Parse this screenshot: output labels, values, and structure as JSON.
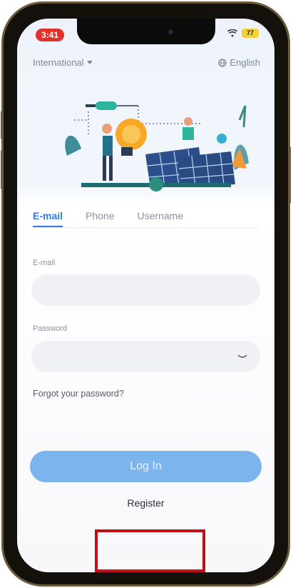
{
  "status_bar": {
    "time": "3:41",
    "battery": "77"
  },
  "header": {
    "region": "International",
    "language": "English"
  },
  "tabs": [
    {
      "label": "E-mail",
      "active": true
    },
    {
      "label": "Phone",
      "active": false
    },
    {
      "label": "Username",
      "active": false
    }
  ],
  "form": {
    "email_label": "E-mail",
    "email_value": "",
    "password_label": "Password",
    "password_value": "",
    "forgot_label": "Forgot your password?",
    "login_label": "Log In",
    "register_label": "Register"
  },
  "colors": {
    "accent": "#2e7be6",
    "button": "#7cb4ee",
    "highlight_box": "#c00f16"
  }
}
